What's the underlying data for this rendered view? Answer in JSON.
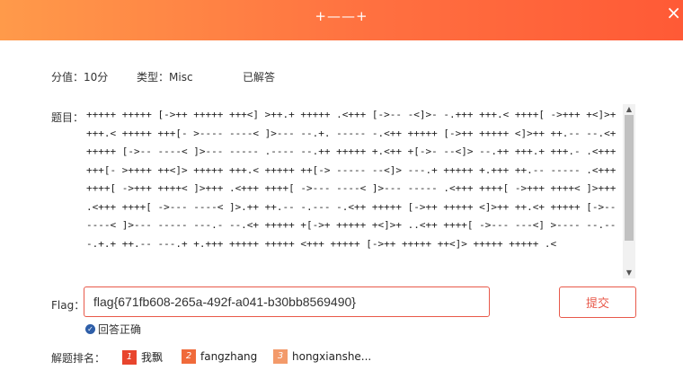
{
  "header": {
    "title": "+——+",
    "close": "×"
  },
  "meta": {
    "score": "分值：10分",
    "category": "类型：Misc",
    "status": "已解答"
  },
  "question": {
    "label": "题目：",
    "text": "+++++ +++++ [->++ +++++ +++<] >++.+ +++++ .<+++ [->-- -<]>- -.+++ +++.< ++++[ ->+++ +<]>+ +++.< +++++ +++[- >---- ----< ]>--- --.+. ----- -.<++ +++++ [->++ +++++ <]>++ ++.-- --.<+ +++++ [->-- ----< ]>--- ----- .---- --.++ +++++ +.<++ +[->- --<]> --.++ +++.+ +++.- .<+++ +++[- >++++ ++<]> +++++ +++.< +++++ ++[-> ----- --<]> ---.+ +++++ +.+++ ++.-- ----- .<+++ ++++[ ->+++ ++++< ]>+++ .<+++ ++++[ ->--- ----< ]>--- ----- .<+++ ++++[ ->+++ ++++< ]>+++ .<+++ ++++[ ->--- ----< ]>.++ ++.-- -.--- -.<++ +++++ [->++ +++++ <]>++ ++.<+ +++++ [->-- ----< ]>--- ----- ---.- --.<+ +++++ +[->+ +++++ +<]>+ ..<++ ++++[ ->--- ---<] >---- --.-- -.+.+ ++.-- ---.+ +.+++ +++++ +++++ <+++ +++++ [->++ +++++ ++<]> +++++ +++++ .<"
  },
  "flag": {
    "label": "Flag：",
    "value": "flag{671fb608-265a-492f-a041-b30bb8569490}",
    "submit_label": "提交"
  },
  "result": {
    "text": "回答正确"
  },
  "ranking": {
    "label": "解题排名：",
    "entries": [
      {
        "rank": "1",
        "name": "我飘"
      },
      {
        "rank": "2",
        "name": "fangzhang"
      },
      {
        "rank": "3",
        "name": "hongxianshe..."
      }
    ]
  },
  "colors": {
    "accent": "#e8594a",
    "header_start": "#ff9a4a",
    "header_end": "#ff5a36"
  }
}
